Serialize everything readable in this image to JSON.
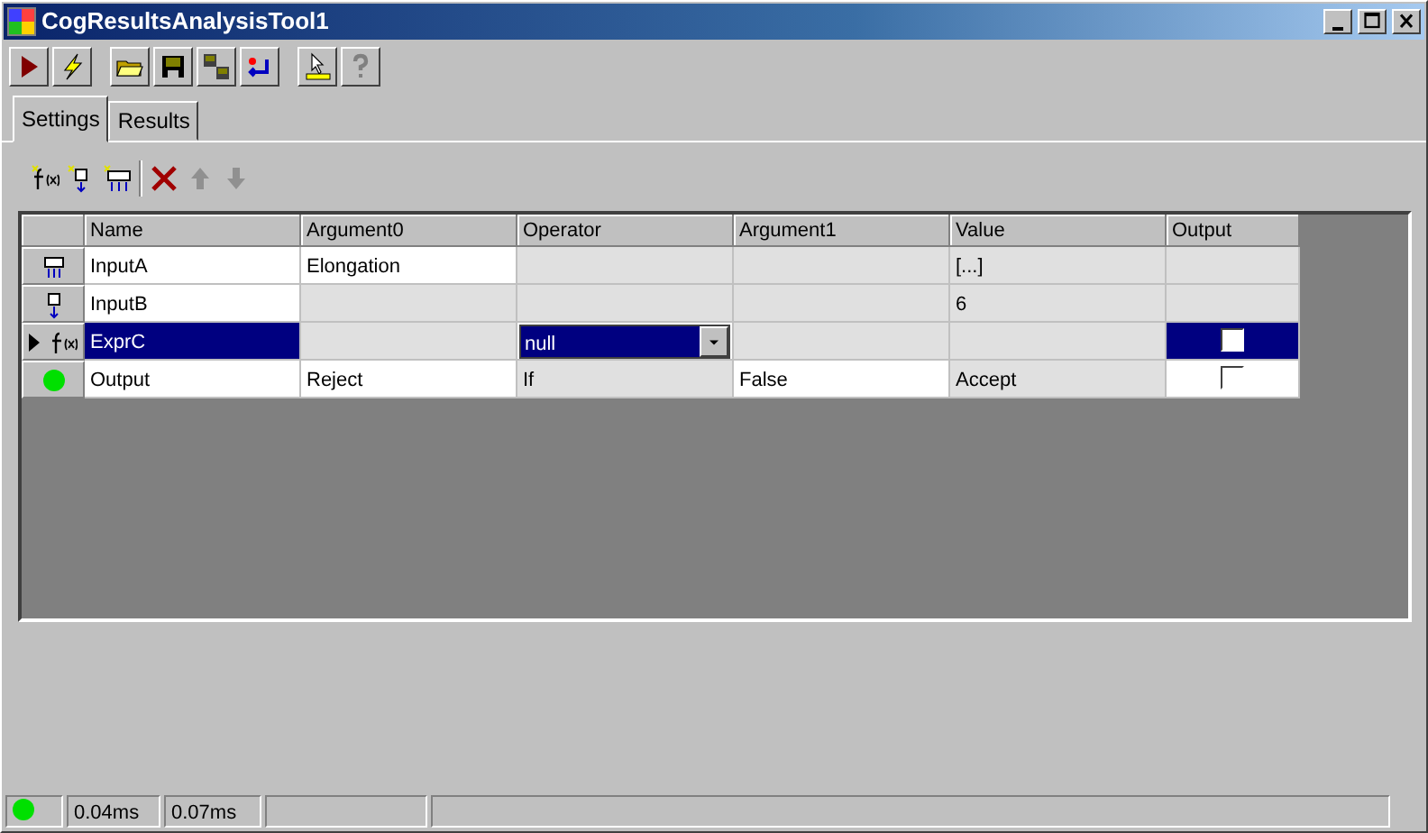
{
  "window": {
    "title": "CogResultsAnalysisTool1"
  },
  "tabs": [
    {
      "label": "Settings",
      "selected": true
    },
    {
      "label": "Results",
      "selected": false
    }
  ],
  "grid": {
    "columns": [
      "Name",
      "Argument0",
      "Operator",
      "Argument1",
      "Value",
      "Output"
    ],
    "rows": [
      {
        "kind": "multi-input",
        "selected": false,
        "cells": [
          {
            "text": "InputA",
            "editable": true
          },
          {
            "text": "Elongation",
            "editable": true
          },
          {
            "text": "",
            "editable": false
          },
          {
            "text": "",
            "editable": false
          },
          {
            "text": "[...]",
            "editable": false
          }
        ]
      },
      {
        "kind": "input",
        "selected": false,
        "cells": [
          {
            "text": "InputB",
            "editable": true
          },
          {
            "text": "",
            "editable": false
          },
          {
            "text": "",
            "editable": false
          },
          {
            "text": "",
            "editable": false
          },
          {
            "text": "6",
            "editable": false
          }
        ]
      },
      {
        "kind": "expression",
        "selected": true,
        "cells": [
          {
            "text": "ExprC"
          },
          {
            "text": "",
            "editable": false
          },
          {
            "text": "null",
            "editable": true,
            "dropdown": true
          },
          {
            "text": "",
            "editable": false
          },
          {
            "text": "",
            "editable": false
          }
        ],
        "output": {
          "checked": false
        }
      },
      {
        "kind": "output",
        "selected": false,
        "cells": [
          {
            "text": "Output",
            "editable": true
          },
          {
            "text": "Reject",
            "editable": true
          },
          {
            "text": "If",
            "editable": false
          },
          {
            "text": "False",
            "editable": true
          },
          {
            "text": "Accept",
            "editable": false
          }
        ],
        "output": {
          "checked": false
        }
      }
    ]
  },
  "status_bar": {
    "ok": true,
    "fields": [
      "0.04ms",
      "0.07ms"
    ]
  }
}
